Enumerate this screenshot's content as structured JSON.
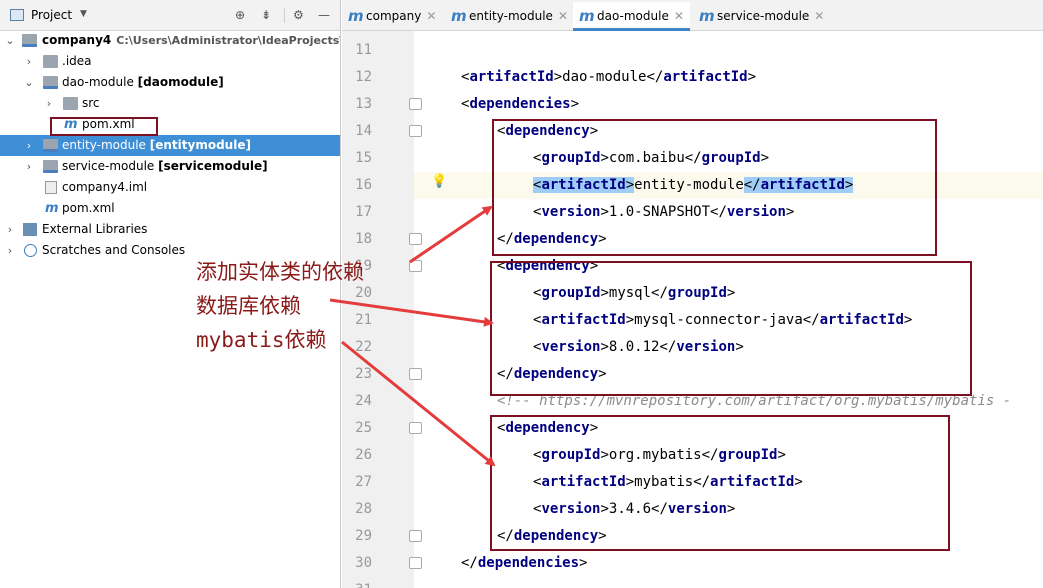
{
  "sidebar": {
    "header": {
      "title": "Project",
      "dropdown_icon": "chevron-down-icon"
    },
    "tree": [
      {
        "label": "company4",
        "suffix": "",
        "path": "C:\\Users\\Administrator\\IdeaProjects\\co",
        "icon": "folder-module-icon"
      },
      {
        "label": ".idea",
        "suffix": "",
        "icon": "folder-icon"
      },
      {
        "label": "dao-module",
        "suffix": "[daomodule]",
        "icon": "folder-module-icon"
      },
      {
        "label": "src",
        "suffix": "",
        "icon": "folder-icon"
      },
      {
        "label": "pom.xml",
        "suffix": "",
        "icon": "maven-icon"
      },
      {
        "label": "entity-module",
        "suffix": "[entitymodule]",
        "icon": "folder-module-icon"
      },
      {
        "label": "service-module",
        "suffix": "[servicemodule]",
        "icon": "folder-module-icon"
      },
      {
        "label": "company4.iml",
        "suffix": "",
        "icon": "iml-file-icon"
      },
      {
        "label": "pom.xml",
        "suffix": "",
        "icon": "maven-icon"
      },
      {
        "label": "External Libraries",
        "suffix": "",
        "icon": "libraries-icon"
      },
      {
        "label": "Scratches and Consoles",
        "suffix": "",
        "icon": "scratches-icon"
      }
    ]
  },
  "tabs": [
    {
      "label": "company",
      "active": false
    },
    {
      "label": "entity-module",
      "active": false
    },
    {
      "label": "dao-module",
      "active": true
    },
    {
      "label": "service-module",
      "active": false
    }
  ],
  "editor": {
    "lines": [
      {
        "n": "11"
      },
      {
        "n": "12"
      },
      {
        "n": "13"
      },
      {
        "n": "14"
      },
      {
        "n": "15"
      },
      {
        "n": "16"
      },
      {
        "n": "17"
      },
      {
        "n": "18"
      },
      {
        "n": "19"
      },
      {
        "n": "20"
      },
      {
        "n": "21"
      },
      {
        "n": "22"
      },
      {
        "n": "23"
      },
      {
        "n": "24"
      },
      {
        "n": "25"
      },
      {
        "n": "26"
      },
      {
        "n": "27"
      },
      {
        "n": "28"
      },
      {
        "n": "29"
      },
      {
        "n": "30"
      },
      {
        "n": "31"
      }
    ],
    "artifactId_value": "dao-module",
    "dep1": {
      "groupId": "com.baibu",
      "artifactId": "entity-module",
      "version": "1.0-SNAPSHOT"
    },
    "dep2": {
      "groupId": "mysql",
      "artifactId": "mysql-connector-java",
      "version": "8.0.12"
    },
    "comment": "<!-- https://mvnrepository.com/artifact/org.mybatis/mybatis -",
    "dep3": {
      "groupId": "org.mybatis",
      "artifactId": "mybatis",
      "version": "3.4.6"
    },
    "tags": {
      "artifactId": "artifactId",
      "dependencies": "dependencies",
      "dependency": "dependency",
      "groupId": "groupId",
      "version": "version"
    }
  },
  "annotations": {
    "entity": "添加实体类的依赖",
    "database": "数据库依赖",
    "mybatis": "mybatis依赖"
  },
  "colors": {
    "annotation": "#8b1a1a",
    "tag": "#000080",
    "selection": "#3e8fd6",
    "highlight": "#9fcdf5"
  }
}
